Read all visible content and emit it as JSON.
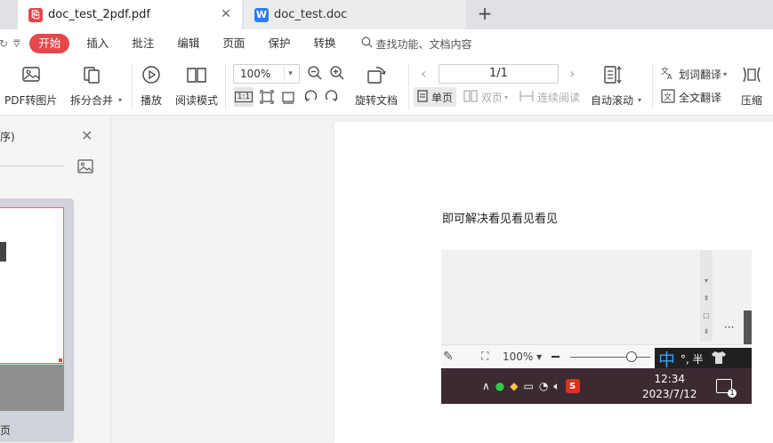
{
  "tabs": [
    {
      "label": "doc_test_2pdf.pdf",
      "active": true,
      "icon": "pdf-icon",
      "color": "#e5474b"
    },
    {
      "label": "doc_test.doc",
      "active": false,
      "icon": "word-icon",
      "color": "#2b7cf6"
    }
  ],
  "menu": {
    "items": [
      "开始",
      "插入",
      "批注",
      "编辑",
      "页面",
      "保护",
      "转换"
    ],
    "search_placeholder": "查找功能、文档内容",
    "accent": "#e5474b"
  },
  "toolbar": {
    "pdf_to_image": "PDF转图片",
    "split_merge": "拆分合并",
    "play": "播放",
    "read_mode": "阅读模式",
    "zoom": "100%",
    "rotate_doc": "旋转文档",
    "page_indicator": "1/1",
    "single_page": "单页",
    "double_page": "双页",
    "continuous": "连续阅读",
    "auto_scroll": "自动滚动",
    "word_translate": "划词翻译",
    "full_translate": "全文翻译",
    "compress": "压缩",
    "fit_label": "1:1"
  },
  "left_panel": {
    "title": "序)",
    "thumb_label": "页"
  },
  "document": {
    "text": "即可解决看见看见看见",
    "screenshot": {
      "zoom": "100%",
      "ime_lang": "中",
      "ime_extra": "°, 半",
      "clock_time": "12:34",
      "clock_date": "2023/7/12",
      "notify_count": "1",
      "dots": "···"
    }
  }
}
